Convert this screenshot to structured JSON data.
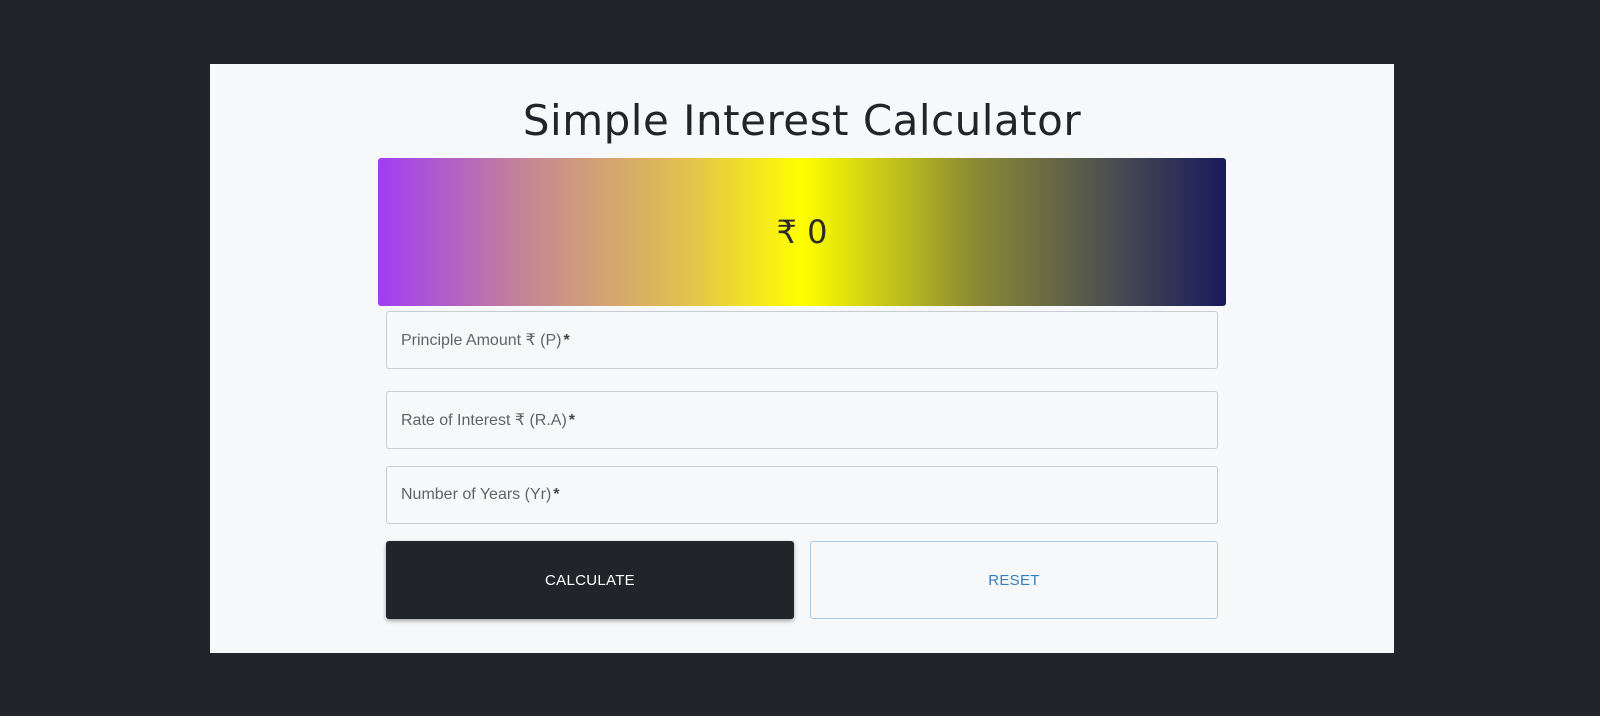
{
  "page": {
    "title": "Simple Interest Calculator"
  },
  "result": {
    "text": "₹ 0"
  },
  "fields": [
    {
      "label": "Principle Amount ₹ (P)",
      "required_mark": "*"
    },
    {
      "label": "Rate of Interest ₹ (R.A)",
      "required_mark": "*"
    },
    {
      "label": "Number of Years (Yr)",
      "required_mark": "*"
    }
  ],
  "buttons": {
    "calculate_label": "CALCULATE",
    "reset_label": "RESET"
  },
  "colors": {
    "background": "#212429",
    "card": "#f7f8fa",
    "primary_button": "#212429",
    "reset_text": "#2f7fc1",
    "gradient": [
      "#a23cf5",
      "#c58892",
      "#e3c34c",
      "#ffff00",
      "#8c8c33",
      "#4a4c52",
      "#181a5c"
    ]
  }
}
